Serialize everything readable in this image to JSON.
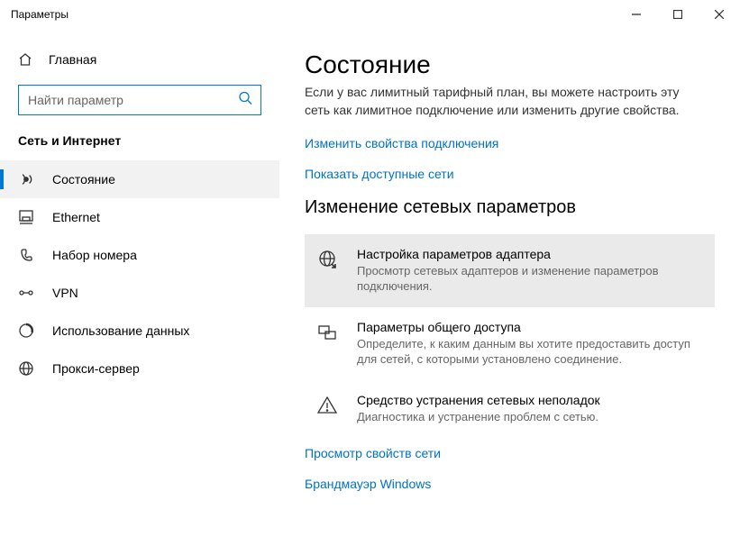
{
  "titlebar": {
    "title": "Параметры"
  },
  "sidebar": {
    "home": "Главная",
    "search_placeholder": "Найти параметр",
    "category": "Сеть и Интернет",
    "items": [
      {
        "label": "Состояние"
      },
      {
        "label": "Ethernet"
      },
      {
        "label": "Набор номера"
      },
      {
        "label": "VPN"
      },
      {
        "label": "Использование данных"
      },
      {
        "label": "Прокси-сервер"
      }
    ]
  },
  "content": {
    "title": "Состояние",
    "desc": "Если у вас лимитный тарифный план, вы можете настроить эту сеть как лимитное подключение или изменить другие свойства.",
    "link_change": "Изменить свойства подключения",
    "link_show": "Показать доступные сети",
    "section_title": "Изменение сетевых параметров",
    "options": [
      {
        "title": "Настройка параметров адаптера",
        "desc": "Просмотр сетевых адаптеров и изменение параметров подключения."
      },
      {
        "title": "Параметры общего доступа",
        "desc": "Определите, к каким данным вы хотите предоставить доступ для сетей, с которыми установлено соединение."
      },
      {
        "title": "Средство устранения сетевых неполадок",
        "desc": "Диагностика и устранение проблем с сетью."
      }
    ],
    "link_props": "Просмотр свойств сети",
    "link_firewall": "Брандмауэр Windows"
  }
}
